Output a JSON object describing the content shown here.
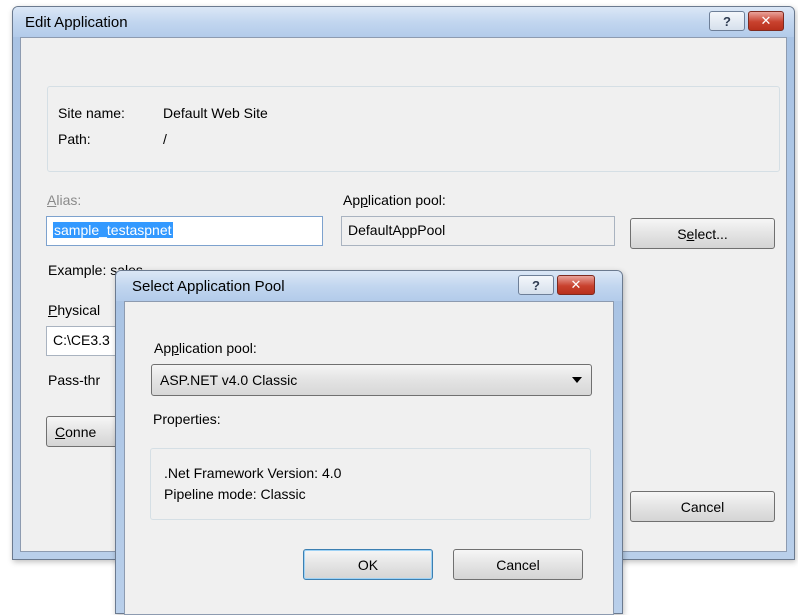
{
  "main": {
    "title": "Edit Application",
    "help_glyph": "?",
    "close_glyph": "✕",
    "site_name_label": "Site name:",
    "site_name_value": "Default Web Site",
    "path_label": "Path:",
    "path_value": "/",
    "alias_label": "Alias:",
    "alias_value": "sample_testaspnet",
    "app_pool_label": "Application pool:",
    "app_pool_value": "DefaultAppPool",
    "select_button": "Select...",
    "example_text": "Example: sales",
    "physical_label": "Physical",
    "physical_value": "C:\\CE3.3",
    "passthru_label": "Pass-thr",
    "connect_button": "Conne",
    "cancel_button": "Cancel"
  },
  "dialog": {
    "title": "Select Application Pool",
    "help_glyph": "?",
    "close_glyph": "✕",
    "app_pool_label": "Application pool:",
    "app_pool_selected": "ASP.NET v4.0 Classic",
    "properties_label": "Properties:",
    "framework_line": ".Net Framework Version: 4.0",
    "pipeline_line": "Pipeline mode: Classic",
    "ok_button": "OK",
    "cancel_button": "Cancel"
  }
}
